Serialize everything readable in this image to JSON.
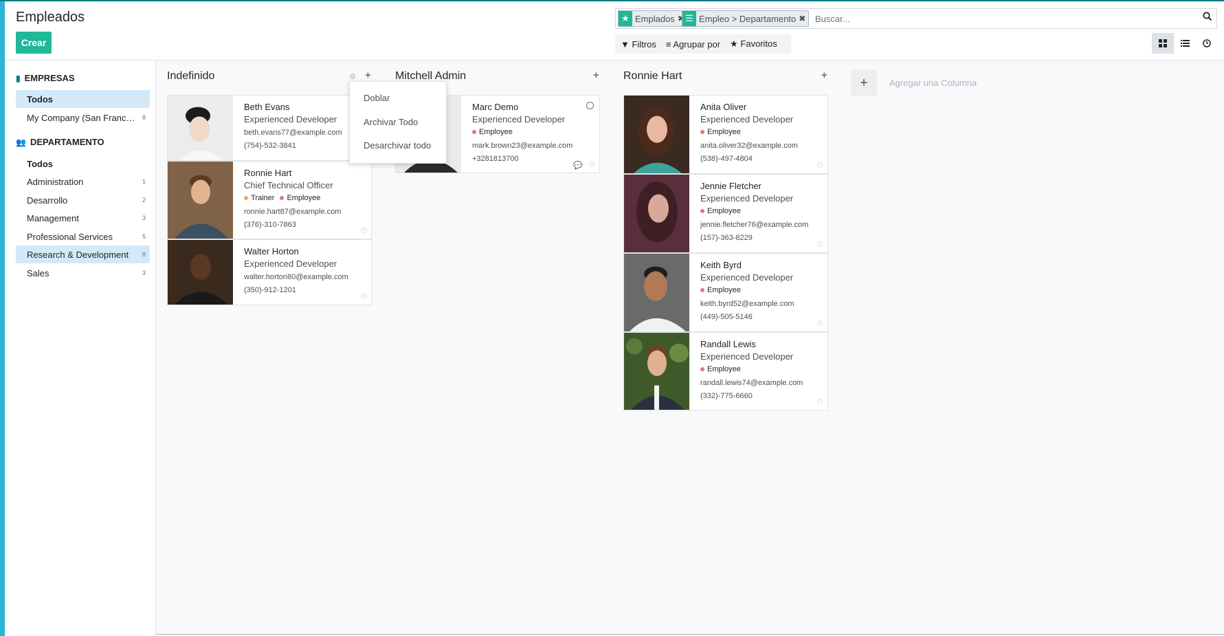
{
  "app": {
    "title": "Empleados",
    "create_label": "Crear"
  },
  "search": {
    "facets": [
      {
        "icon": "star-icon",
        "label": "Emplados"
      },
      {
        "icon": "list-icon",
        "label": "Empleo > Departamento"
      }
    ],
    "placeholder": "Buscar..."
  },
  "filters": {
    "filtros": "Filtros",
    "agrupar": "Agrupar por",
    "favoritos": "Favoritos"
  },
  "views": [
    "kanban-view",
    "list-view",
    "activity-view"
  ],
  "panel": {
    "empresas": {
      "title": "EMPRESAS",
      "items": [
        {
          "label": "Todos",
          "count": ""
        },
        {
          "label": "My Company (San Francis...",
          "count": "8"
        }
      ]
    },
    "departamento": {
      "title": "DEPARTAMENTO",
      "items": [
        {
          "label": "Todos",
          "count": ""
        },
        {
          "label": "Administration",
          "count": "1"
        },
        {
          "label": "Desarrollo",
          "count": "2"
        },
        {
          "label": "Management",
          "count": "3"
        },
        {
          "label": "Professional Services",
          "count": "5"
        },
        {
          "label": "Research & Development",
          "count": "8"
        },
        {
          "label": "Sales",
          "count": "3"
        }
      ]
    }
  },
  "columns": [
    {
      "title": "Indefinido",
      "cards": [
        {
          "name": "Beth Evans",
          "job": "Experienced Developer",
          "tags": [],
          "email": "beth.evans77@example.com",
          "phone": "(754)-532-3841"
        },
        {
          "name": "Ronnie Hart",
          "job": "Chief Technical Officer",
          "tags": [
            {
              "label": "Trainer",
              "color": "#f0ad4e"
            },
            {
              "label": "Employee",
              "color": "#e5737f"
            }
          ],
          "email": "ronnie.hart87@example.com",
          "phone": "(376)-310-7863"
        },
        {
          "name": "Walter Horton",
          "job": "Experienced Developer",
          "tags": [],
          "email": "walter.horton80@example.com",
          "phone": "(350)-912-1201"
        }
      ]
    },
    {
      "title": "Mitchell Admin",
      "cards": [
        {
          "name": "Marc Demo",
          "job": "Experienced Developer",
          "tags": [
            {
              "label": "Employee",
              "color": "#e5737f"
            }
          ],
          "email": "mark.brown23@example.com",
          "phone": "+3281813700"
        }
      ]
    },
    {
      "title": "Ronnie Hart",
      "cards": [
        {
          "name": "Anita Oliver",
          "job": "Experienced Developer",
          "tags": [
            {
              "label": "Employee",
              "color": "#e5737f"
            }
          ],
          "email": "anita.oliver32@example.com",
          "phone": "(538)-497-4804"
        },
        {
          "name": "Jennie Fletcher",
          "job": "Experienced Developer",
          "tags": [
            {
              "label": "Employee",
              "color": "#e5737f"
            }
          ],
          "email": "jennie.fletcher76@example.com",
          "phone": "(157)-363-8229"
        },
        {
          "name": "Keith Byrd",
          "job": "Experienced Developer",
          "tags": [
            {
              "label": "Employee",
              "color": "#e5737f"
            }
          ],
          "email": "keith.byrd52@example.com",
          "phone": "(449)-505-5146"
        },
        {
          "name": "Randall Lewis",
          "job": "Experienced Developer",
          "tags": [
            {
              "label": "Employee",
              "color": "#e5737f"
            }
          ],
          "email": "randall.lewis74@example.com",
          "phone": "(332)-775-6660"
        }
      ]
    }
  ],
  "column_menu": {
    "items": [
      "Doblar",
      "Archivar Todo",
      "Desarchivar todo"
    ]
  },
  "add_column": {
    "label": "Agregar una Columna"
  },
  "colors": {
    "primary": "#21b799",
    "accent": "#017e84",
    "sidebar_strip": "#2bb6d7",
    "active_bg": "#d4e9f7"
  }
}
